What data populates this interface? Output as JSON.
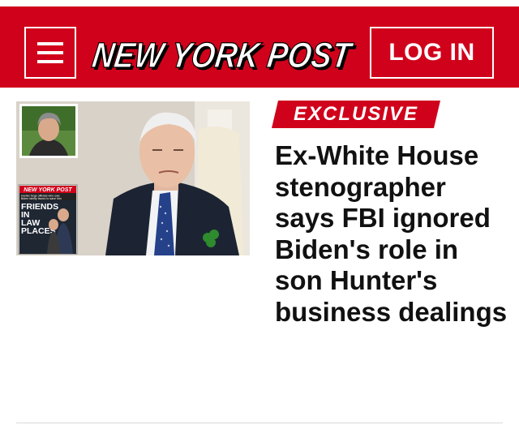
{
  "header": {
    "menu_icon": "hamburger-menu-icon",
    "logo_text": "NEW YORK POST",
    "login_label": "LOG IN",
    "brand_color": "#d0021b"
  },
  "story": {
    "badge_label": "EXCLUSIVE",
    "headline": "Ex-White House stenographer says FBI ignored Biden's role in son Hunter's business dealings",
    "image": {
      "inset_cover_masthead": "NEW YORK POST",
      "inset_cover_subhead": "Hunter begs officials who owe Biden family favors to save him",
      "inset_cover_headline": "FRIENDS IN LAW PLACES"
    }
  }
}
